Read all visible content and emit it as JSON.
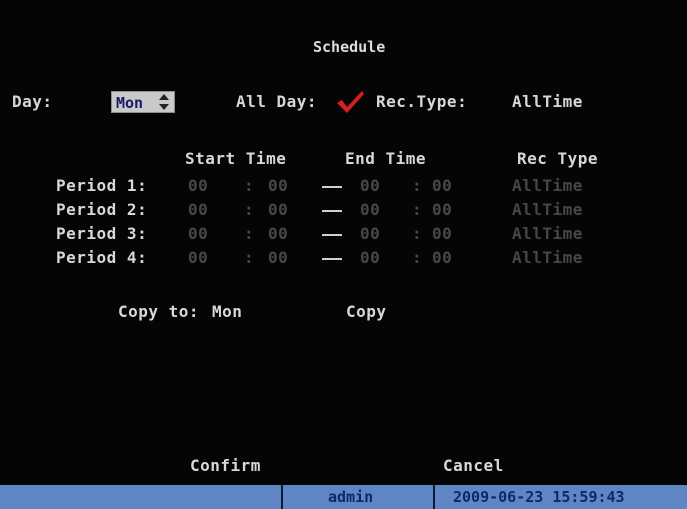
{
  "title": "Schedule",
  "day": {
    "label": "Day:",
    "value": "Mon"
  },
  "all_day": {
    "label": "All Day:"
  },
  "rec_type": {
    "label": "Rec.Type:",
    "value": "AllTime"
  },
  "columns": {
    "start": "Start Time",
    "end": "End Time",
    "rec": "Rec Type"
  },
  "periods": [
    {
      "label": "Period 1:",
      "start_h": "00",
      "start_m": "00",
      "end_h": "00",
      "end_m": "00",
      "type": "AllTime"
    },
    {
      "label": "Period 2:",
      "start_h": "00",
      "start_m": "00",
      "end_h": "00",
      "end_m": "00",
      "type": "AllTime"
    },
    {
      "label": "Period 3:",
      "start_h": "00",
      "start_m": "00",
      "end_h": "00",
      "end_m": "00",
      "type": "AllTime"
    },
    {
      "label": "Period 4:",
      "start_h": "00",
      "start_m": "00",
      "end_h": "00",
      "end_m": "00",
      "type": "AllTime"
    }
  ],
  "colon": ":",
  "copy": {
    "label": "Copy to:",
    "value": "Mon",
    "button": "Copy"
  },
  "buttons": {
    "confirm": "Confirm",
    "cancel": "Cancel"
  },
  "status": {
    "user": "admin",
    "datetime": "2009-06-23 15:59:43"
  },
  "colors": {
    "background": "#050505",
    "statusbar": "#5f86c4",
    "check": "#d42020"
  }
}
